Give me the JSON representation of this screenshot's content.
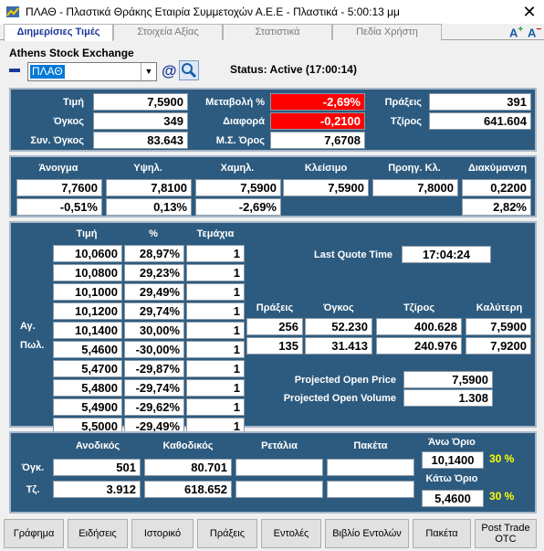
{
  "window": {
    "title": "ΠΛΑΘ - Πλαστικά Θράκης Εταιρία Συμμετοχών Α.Ε.Ε - Πλαστικά - 5:00:13 μμ",
    "close": "✕"
  },
  "tabs": [
    "Διημερίσιες Τιμές",
    "Στοιχεία Αξίας",
    "Στατιστικά",
    "Πεδία Χρήστη"
  ],
  "font_buttons": {
    "larger": "A",
    "larger_sign": "+",
    "smaller": "A",
    "smaller_sign": "−"
  },
  "header": {
    "exchange": "Athens Stock Exchange",
    "symbol": "ΠΛΑΘ",
    "status": "Status: Active (17:00:14)",
    "at_icon": "@"
  },
  "summary": {
    "price_label": "Τιμή",
    "price": "7,5900",
    "change_pct_label": "Μεταβολή %",
    "change_pct": "-2,69%",
    "trades_label": "Πράξεις",
    "trades": "391",
    "volume_label": "Όγκος",
    "volume": "349",
    "diff_label": "Διαφορά",
    "diff": "-0,2100",
    "turnover_label": "Τζίρος",
    "turnover": "641.604",
    "total_volume_label": "Συν. Όγκος",
    "total_volume": "83.643",
    "avg_label": "Μ.Σ. Όρος",
    "avg": "7,6708"
  },
  "ohlc": {
    "headers": [
      "Άνοιγμα",
      "Υψηλ.",
      "Χαμηλ.",
      "Κλείσιμο",
      "Προηγ. Κλ.",
      "Διακύμανση"
    ],
    "values": [
      "7,7600",
      "7,8100",
      "7,5900",
      "7,5900",
      "7,8000",
      "0,2200"
    ],
    "pcts": [
      "-0,51%",
      "0,13%",
      "-2,69%",
      "2,82%"
    ]
  },
  "depth": {
    "headers": {
      "price": "Τιμή",
      "pct": "%",
      "pieces": "Τεμάχια"
    },
    "rows": [
      [
        "10,0600",
        "28,97%",
        "1"
      ],
      [
        "10,0800",
        "29,23%",
        "1"
      ],
      [
        "10,1000",
        "29,49%",
        "1"
      ],
      [
        "10,1200",
        "29,74%",
        "1"
      ],
      [
        "10,1400",
        "30,00%",
        "1"
      ],
      [
        "5,4600",
        "-30,00%",
        "1"
      ],
      [
        "5,4700",
        "-29,87%",
        "1"
      ],
      [
        "5,4800",
        "-29,74%",
        "1"
      ],
      [
        "5,4900",
        "-29,62%",
        "1"
      ],
      [
        "5,5000",
        "-29,49%",
        "1"
      ]
    ],
    "buy_label": "Αγ.",
    "sell_label": "Πωλ.",
    "last_quote_label": "Last Quote Time",
    "last_quote_time": "17:04:24",
    "stats_headers": [
      "Πράξεις",
      "Όγκος",
      "Τζίρος",
      "Καλύτερη"
    ],
    "buy_stats": [
      "256",
      "52.230",
      "400.628",
      "7,5900"
    ],
    "sell_stats": [
      "135",
      "31.413",
      "240.976",
      "7,9200"
    ],
    "projected_price_label": "Projected Open Price",
    "projected_price": "7,5900",
    "projected_volume_label": "Projected Open Volume",
    "projected_volume": "1.308"
  },
  "bottom": {
    "headers": [
      "Ανοδικός",
      "Καθοδικός",
      "Ρετάλια",
      "Πακέτα"
    ],
    "vol_label": "Όγκ.",
    "vol": [
      "501",
      "80.701",
      "",
      ""
    ],
    "tz_label": "Τζ.",
    "tz": [
      "3.912",
      "618.652",
      "",
      ""
    ],
    "upper_label": "Άνω Όριο",
    "upper": "10,1400",
    "upper_pct": "30 %",
    "lower_label": "Κάτω Όριο",
    "lower": "5,4600",
    "lower_pct": "30 %"
  },
  "buttons": [
    "Γράφημα",
    "Ειδήσεις",
    "Ιστορικό",
    "Πράξεις",
    "Εντολές",
    "Βιβλίο Εντολών",
    "Πακέτα",
    "Post Trade OTC"
  ],
  "colors": {
    "panel": "#2d5b7f",
    "negative": "#ff0000",
    "limit_pct": "#ffff00"
  }
}
